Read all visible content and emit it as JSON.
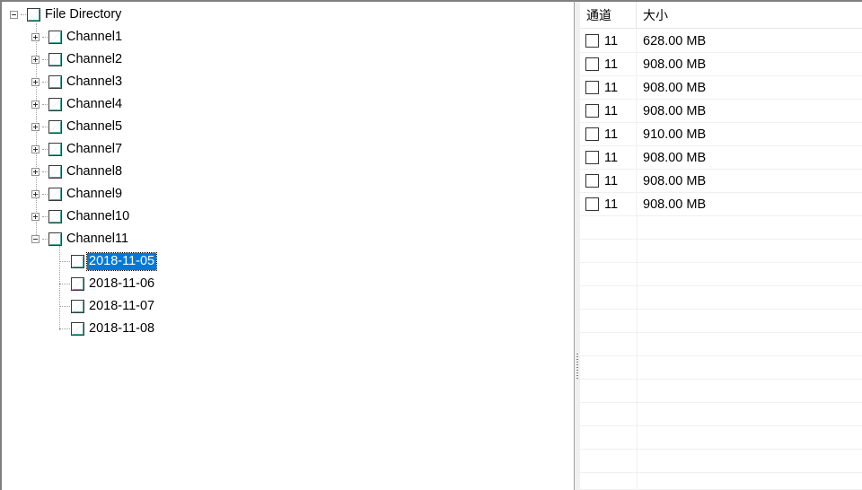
{
  "tree": {
    "root": {
      "label": "File Directory",
      "expanded": true
    },
    "channels": [
      {
        "label": "Channel1",
        "expanded": false
      },
      {
        "label": "Channel2",
        "expanded": false
      },
      {
        "label": "Channel3",
        "expanded": false
      },
      {
        "label": "Channel4",
        "expanded": false
      },
      {
        "label": "Channel5",
        "expanded": false
      },
      {
        "label": "Channel7",
        "expanded": false
      },
      {
        "label": "Channel8",
        "expanded": false
      },
      {
        "label": "Channel9",
        "expanded": false
      },
      {
        "label": "Channel10",
        "expanded": false
      },
      {
        "label": "Channel11",
        "expanded": true
      }
    ],
    "dates": [
      {
        "label": "2018-11-05",
        "selected": true
      },
      {
        "label": "2018-11-06",
        "selected": false
      },
      {
        "label": "2018-11-07",
        "selected": false
      },
      {
        "label": "2018-11-08",
        "selected": false
      }
    ]
  },
  "list": {
    "columns": [
      "通道",
      "大小"
    ],
    "rows": [
      {
        "channel": "11",
        "size": "628.00 MB"
      },
      {
        "channel": "11",
        "size": "908.00 MB"
      },
      {
        "channel": "11",
        "size": "908.00 MB"
      },
      {
        "channel": "11",
        "size": "908.00 MB"
      },
      {
        "channel": "11",
        "size": "910.00 MB"
      },
      {
        "channel": "11",
        "size": "908.00 MB"
      },
      {
        "channel": "11",
        "size": "908.00 MB"
      },
      {
        "channel": "11",
        "size": "908.00 MB"
      }
    ]
  },
  "colors": {
    "selection": "#0078d7",
    "check_accent": "#2f9e8f"
  }
}
